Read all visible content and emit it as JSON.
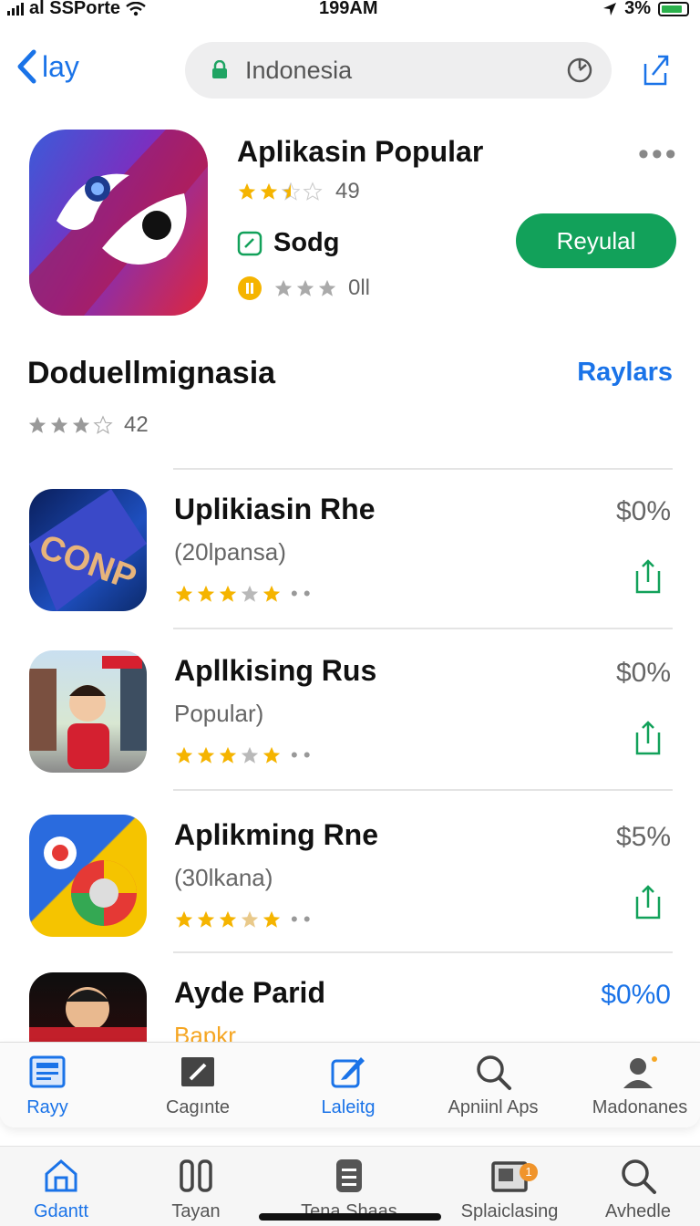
{
  "status_bar": {
    "carrier": "al SSPorte",
    "time": "199AM",
    "battery": "3%"
  },
  "nav": {
    "back_label": "lay",
    "url": "Indonesia"
  },
  "header_app": {
    "title": "Aplikasin Popular",
    "rating_count": "49",
    "category": "Sodg",
    "secondary_count": "0ll",
    "get_button": "Reyulal",
    "more": "•••"
  },
  "section": {
    "title": "Doduellmignasia",
    "link": "Raylars",
    "rating_count": "42"
  },
  "apps": [
    {
      "name": "Uplikiasin Rhe",
      "subtitle": "(20lpansa)",
      "price": "$0%",
      "rating": 3.5
    },
    {
      "name": "Apllkising Rus",
      "subtitle": "Popular)",
      "price": "$0%",
      "rating": 3.5
    },
    {
      "name": "Aplikming Rne",
      "subtitle": "(30lkana)",
      "price": "$5%",
      "rating": 3.5
    },
    {
      "name": "Ayde Parid",
      "subtitle": "Bapkr",
      "price": "$0%0"
    }
  ],
  "tabbar_top": {
    "tabs": [
      {
        "label": "Rayy",
        "icon": "news-icon"
      },
      {
        "label": "Cagınte",
        "icon": "pencil-box-icon"
      },
      {
        "label": "Laleitg",
        "icon": "edit-icon"
      },
      {
        "label": "Apniinl Aps",
        "icon": "search-icon"
      },
      {
        "label": "Madonanes",
        "icon": "profile-icon"
      }
    ]
  },
  "tabbar_bottom": {
    "tabs": [
      {
        "label": "Gdantt",
        "icon": "home-icon"
      },
      {
        "label": "Tayan",
        "icon": "columns-icon"
      },
      {
        "label": "Tena Shaas",
        "icon": "document-icon"
      },
      {
        "label": "Splaiclasing",
        "icon": "folder-icon",
        "badge": "1"
      },
      {
        "label": "Avhedle",
        "icon": "search-icon"
      }
    ]
  },
  "colors": {
    "accent": "#1a73e8",
    "get_button": "#12a15a",
    "star": "#f5b400"
  }
}
